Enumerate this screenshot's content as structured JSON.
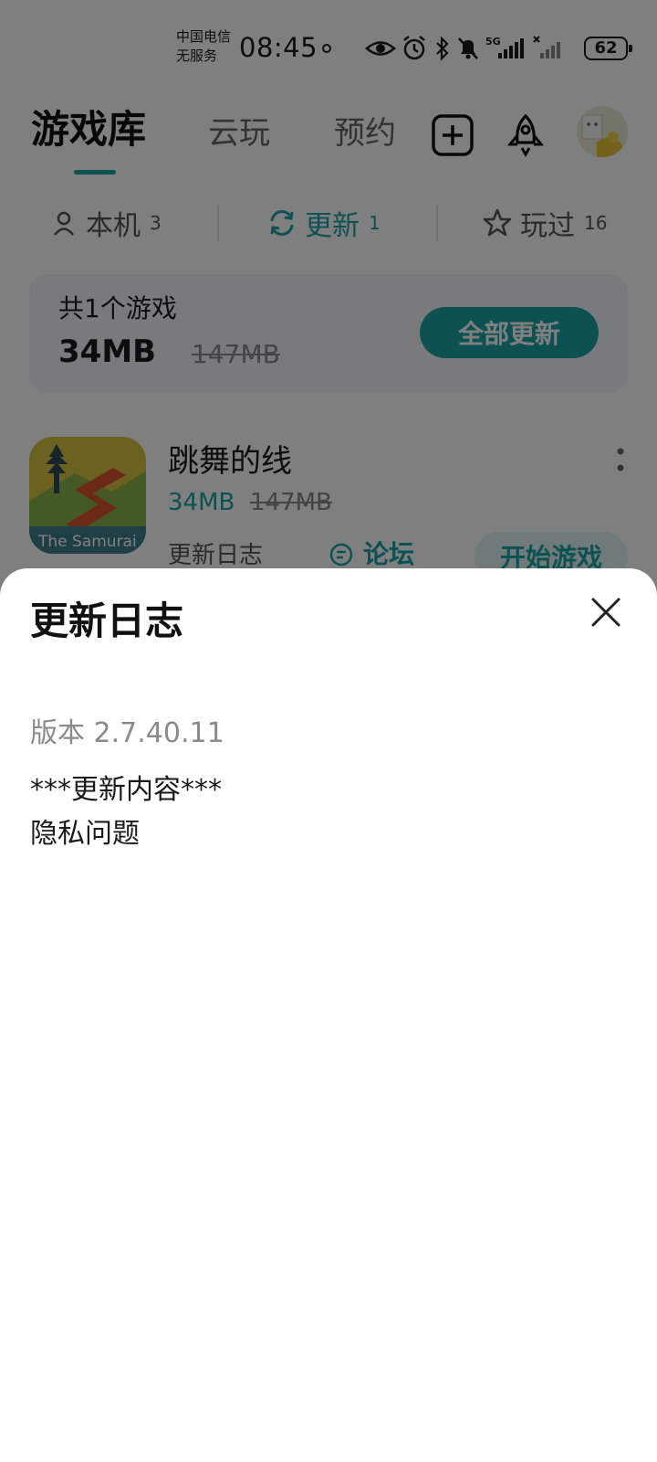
{
  "status_bar": {
    "carrier_line1": "中国电信",
    "carrier_line2": "无服务",
    "time": "08:45",
    "network": "5G",
    "battery": "62"
  },
  "top_nav": {
    "tabs": [
      {
        "label": "游戏库",
        "active": true
      },
      {
        "label": "云玩",
        "active": false
      },
      {
        "label": "预约",
        "active": false
      }
    ],
    "icons": [
      "add-icon",
      "rocket-icon",
      "avatar"
    ]
  },
  "segments": [
    {
      "label": "本机",
      "count": "3",
      "icon": "person-icon",
      "active": false
    },
    {
      "label": "更新",
      "count": "1",
      "icon": "refresh-icon",
      "active": true
    },
    {
      "label": "玩过",
      "count": "16",
      "icon": "star-icon",
      "active": false
    }
  ],
  "summary": {
    "count_text": "共1个游戏",
    "size": "34MB",
    "original_size": "147MB",
    "update_all_label": "全部更新"
  },
  "game": {
    "title": "跳舞的线",
    "size": "34MB",
    "original_size": "147MB",
    "icon_caption": "The Samurai",
    "changelog_label": "更新日志",
    "forum_label": "论坛",
    "play_label": "开始游戏"
  },
  "sheet": {
    "title": "更新日志",
    "version": "版本 2.7.40.11",
    "content_lines": [
      "***更新内容***",
      "隐私问题"
    ]
  },
  "colors": {
    "accent": "#1aa3a6",
    "overlay": "rgba(0,0,0,0.5)"
  }
}
